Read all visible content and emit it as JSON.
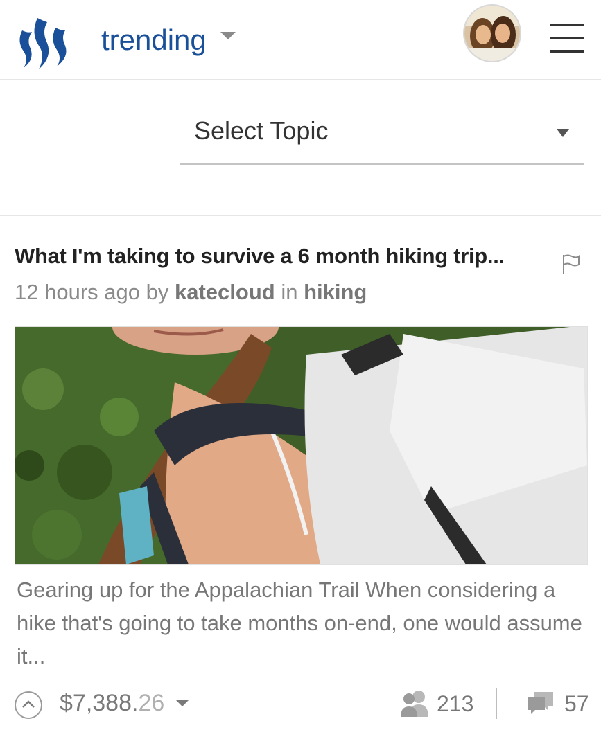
{
  "header": {
    "logo_icon": "steemit-logo-icon",
    "page_label": "trending",
    "menu_icon": "hamburger-menu-icon",
    "brand_color": "#1a5099"
  },
  "topic_select": {
    "label": "Select Topic"
  },
  "post": {
    "title": "What I'm taking to survive a 6 month hiking trip...",
    "time": "12 hours ago",
    "by_text": "by",
    "author": "katecloud",
    "in_text": "in",
    "category": "hiking",
    "summary": "Gearing up for the Appalachian Trail When considering a hike that's going to take months on-end, one would assume it...",
    "payout_main": "$7,388.",
    "payout_cents": "26",
    "voters": "213",
    "comments": "57"
  }
}
